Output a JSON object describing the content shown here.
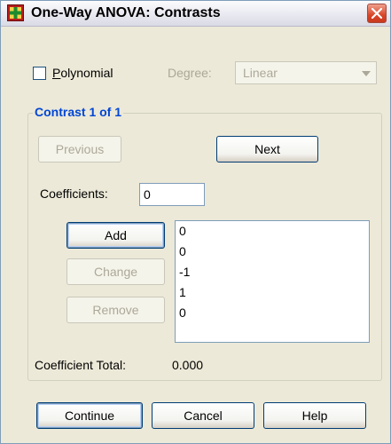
{
  "window": {
    "title": "One-Way ANOVA: Contrasts"
  },
  "polynomial": {
    "label": "Polynomial",
    "checked": false
  },
  "degree": {
    "label": "Degree:",
    "value": "Linear"
  },
  "contrast_group": {
    "title": "Contrast 1 of 1",
    "previous_label": "Previous",
    "next_label": "Next",
    "coefficients_label": "Coefficients:",
    "coefficients_value": "0",
    "add_label": "Add",
    "change_label": "Change",
    "remove_label": "Remove",
    "coefficients_list": [
      "0",
      "0",
      "-1",
      "1",
      "0"
    ],
    "total_label": "Coefficient Total:",
    "total_value": "0.000"
  },
  "buttons": {
    "continue_label": "Continue",
    "cancel_label": "Cancel",
    "help_label": "Help"
  },
  "colors": {
    "group_title": "#0046d5",
    "background": "#ece9d8",
    "close_button": "#d8462a"
  }
}
